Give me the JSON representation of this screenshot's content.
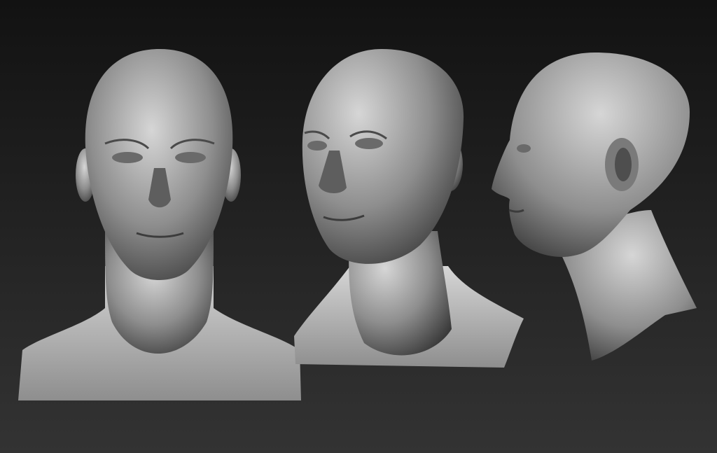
{
  "scene": {
    "background_top": "#121212",
    "background_bottom": "#333333",
    "sculpt_light": "#d6d6d6",
    "sculpt_mid": "#8e8e8e",
    "sculpt_dark": "#3a3a3a"
  },
  "views": [
    {
      "view": "front"
    },
    {
      "view": "three-quarter"
    },
    {
      "view": "profile"
    }
  ]
}
